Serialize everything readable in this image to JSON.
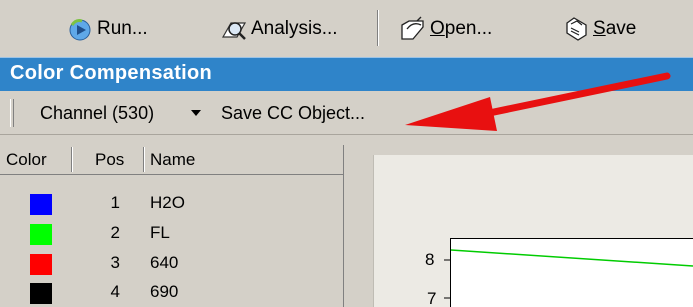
{
  "toolbar": {
    "run_label": "Run...",
    "analysis_label": "Analysis...",
    "open_prefix": "",
    "open_underlined": "O",
    "open_rest": "pen...",
    "save_underlined": "S",
    "save_rest": "ave"
  },
  "window": {
    "title": "Color Compensation"
  },
  "subtoolbar": {
    "channel_label": "Channel (530)",
    "save_cc_label": "Save CC Object..."
  },
  "table": {
    "headers": [
      "Color",
      "Pos",
      "Name"
    ],
    "rows": [
      {
        "color": "#0000ff",
        "pos": "1",
        "name": "H2O"
      },
      {
        "color": "#00ff00",
        "pos": "2",
        "name": "FL"
      },
      {
        "color": "#ff0000",
        "pos": "3",
        "name": "640"
      },
      {
        "color": "#000000",
        "pos": "4",
        "name": "690"
      }
    ]
  },
  "chart": {
    "y_ticks": [
      "8",
      "7"
    ],
    "line_color": "#00cc00"
  },
  "annotation": {
    "arrow_color": "#e81010"
  }
}
